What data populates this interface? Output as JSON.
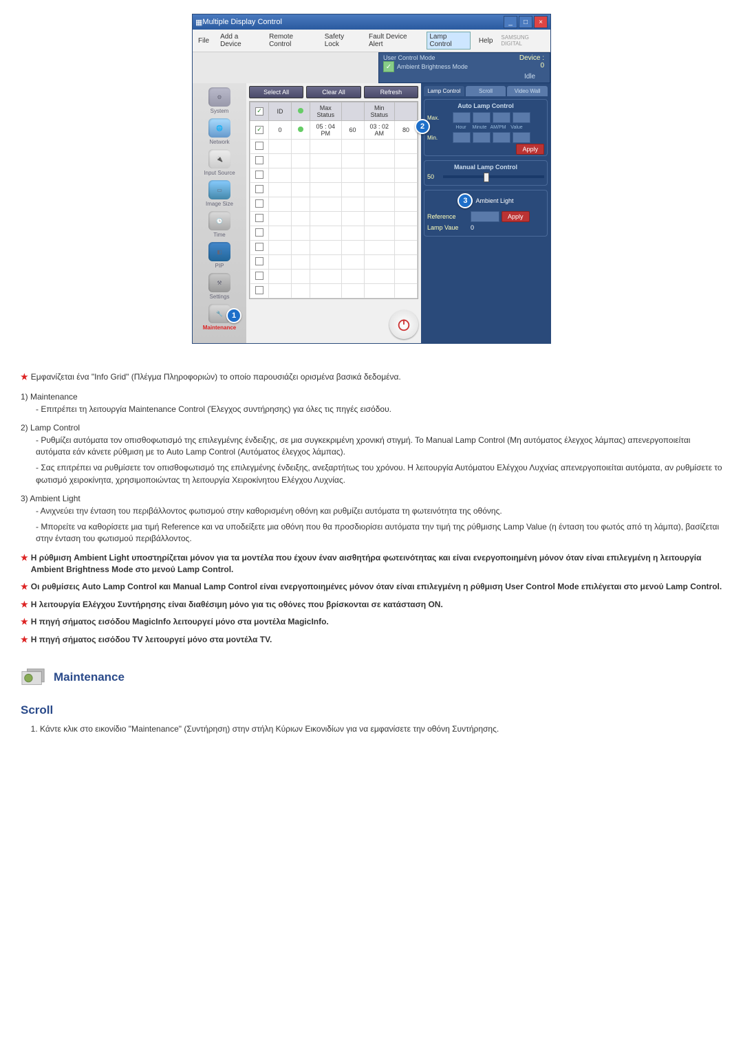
{
  "app": {
    "title": "Multiple Display Control",
    "menus": [
      "File",
      "Add a Device",
      "Remote Control",
      "Safety Lock",
      "Fault Device Alert",
      "Lamp Control",
      "Help"
    ],
    "highlighted_menu_index": 5,
    "brand": "SAMSUNG DIGITAL",
    "topstatus": {
      "mode1": "User Control Mode",
      "mode2": "Ambient Brightness Mode",
      "device": "Device : 0",
      "idle": "Idle"
    },
    "sidebar": [
      {
        "label": "System"
      },
      {
        "label": "Network"
      },
      {
        "label": "Input Source"
      },
      {
        "label": "Image Size"
      },
      {
        "label": "Time"
      },
      {
        "label": "PIP"
      },
      {
        "label": "Settings"
      },
      {
        "label": "Maintenance"
      }
    ],
    "toolbar": [
      "Select All",
      "Clear All",
      "Refresh"
    ],
    "grid": {
      "headers": [
        "",
        "ID",
        "",
        "Max Status",
        "",
        "Min Status",
        ""
      ],
      "row": {
        "id": "0",
        "max": "05 : 04  PM",
        "maxv": "60",
        "min": "03 : 02  AM",
        "minv": "80"
      }
    },
    "right": {
      "tabs": [
        "Lamp Control",
        "Scroll",
        "Video Wall"
      ],
      "activeTab": 0,
      "autoTitle": "Auto Lamp Control",
      "maxLabel": "Max.",
      "minLabel": "Min.",
      "colHeads": [
        "Hour",
        "Minute",
        "AM/PM",
        "Value"
      ],
      "apply": "Apply",
      "manualTitle": "Manual Lamp Control",
      "manualValue": "50",
      "ambientTitle": "Ambient Light",
      "reference": "Reference",
      "lampValueLabel": "Lamp Vaue",
      "lampValue": "0",
      "badge2": "2",
      "badge3": "3"
    },
    "badge1": "1"
  },
  "doc": {
    "intro": "Εμφανίζεται ένα \"Info Grid\" (Πλέγμα Πληροφοριών) το οποίο παρουσιάζει ορισμένα βασικά δεδομένα.",
    "items": [
      {
        "num": "1)",
        "title": "Maintenance",
        "subs": [
          "Επιτρέπει τη λειτουργία Maintenance Control (Έλεγχος συντήρησης) για όλες τις πηγές εισόδου."
        ]
      },
      {
        "num": "2)",
        "title": "Lamp Control",
        "subs": [
          "Ρυθμίζει αυτόματα τον οπισθοφωτισμό της επιλεγμένης ένδειξης, σε μια συγκεκριμένη χρονική στιγμή. Το Manual Lamp Control (Μη αυτόματος έλεγχος λάμπας) απενεργοποιείται αυτόματα εάν κάνετε ρύθμιση με το Auto Lamp Control (Αυτόματος έλεγχος λάμπας).",
          "Σας επιτρέπει να ρυθμίσετε τον οπισθοφωτισμό της επιλεγμένης ένδειξης, ανεξαρτήτως του χρόνου. Η λειτουργία Αυτόματου Ελέγχου Λυχνίας απενεργοποιείται αυτόματα, αν ρυθμίσετε το φωτισμό χειροκίνητα, χρησιμοποιώντας τη λειτουργία Χειροκίνητου Ελέγχου Λυχνίας."
        ]
      },
      {
        "num": "3)",
        "title": "Ambient Light",
        "subs": [
          "Ανιχνεύει την ένταση του περιβάλλοντος φωτισμού στην καθορισμένη οθόνη και ρυθμίζει αυτόματα τη φωτεινότητα της οθόνης.",
          "Μπορείτε να καθορίσετε μια τιμή Reference και να υποδείξετε μια οθόνη που θα προσδιορίσει αυτόματα την τιμή της ρύθμισης Lamp Value (η ένταση του φωτός από τη λάμπα), βασίζεται στην ένταση του φωτισμού περιβάλλοντος."
        ]
      }
    ],
    "notes": [
      "Η ρύθμιση Ambient Light υποστηρίζεται μόνον για τα μοντέλα που έχουν έναν αισθητήρα φωτεινότητας και είναι ενεργοποιημένη μόνον όταν είναι επιλεγμένη η λειτουργία Ambient Brightness Mode στο μενού Lamp Control.",
      "Οι ρυθμίσεις Auto Lamp Control και Manual Lamp Control είναι ενεργοποιημένες μόνον όταν είναι επιλεγμένη η ρύθμιση User Control Mode επιλέγεται στο μενού Lamp Control.",
      "Η λειτουργία Ελέγχου Συντήρησης είναι διαθέσιμη μόνο για τις οθόνες που βρίσκονται σε κατάσταση ΟΝ.",
      "Η πηγή σήματος εισόδου MagicInfo λειτουργεί μόνο στα μοντέλα MagicInfo.",
      "Η πηγή σήματος εισόδου TV λειτουργεί μόνο στα μοντέλα TV."
    ],
    "secTitle": "Maintenance",
    "scrollTitle": "Scroll",
    "scrollStep": "Κάντε κλικ στο εικονίδιο \"Maintenance\" (Συντήρηση) στην στήλη Κύριων Εικονιδίων για να εμφανίσετε την οθόνη Συντήρησης."
  }
}
